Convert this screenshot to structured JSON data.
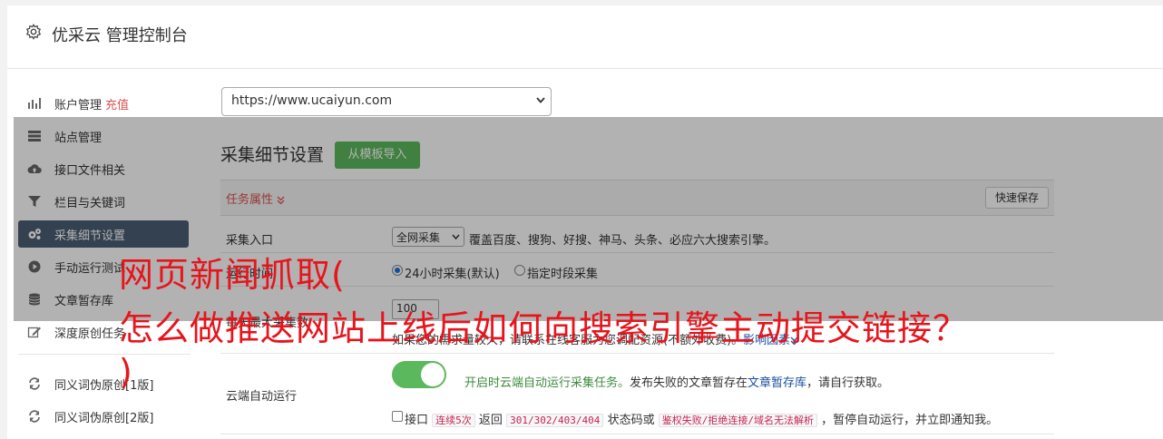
{
  "header": {
    "title": "优采云 管理控制台"
  },
  "sidebar": {
    "items": [
      {
        "label": "账户管理",
        "badge": "充值"
      },
      {
        "label": "站点管理"
      },
      {
        "label": "接口文件相关"
      },
      {
        "label": "栏目与关键词"
      },
      {
        "label": "采集细节设置"
      },
      {
        "label": "手动运行测试"
      },
      {
        "label": "文章暂存库"
      },
      {
        "label": "深度原创任务"
      },
      {
        "label": "同义词伪原创[1版]"
      },
      {
        "label": "同义词伪原创[2版]"
      }
    ]
  },
  "site_select": {
    "value": "https://www.ucaiyun.com"
  },
  "section": {
    "title": "采集细节设置",
    "import_button": "从模板导入",
    "task_attr": "任务属性",
    "save_button": "快速保存"
  },
  "rows": {
    "entry_label": "采集入口",
    "entry_select": "全网采集",
    "entry_desc": "覆盖百度、搜狗、好搜、神马、头条、必应六大搜索引擎。",
    "time_label": "运行时间",
    "time_opt1": "24小时采集(默认)",
    "time_opt2": "指定时段采集",
    "max_label": "每天最大采集数",
    "max_value": "100",
    "max_desc": "如果您的需求量较大，请联系在线客服为您调配资源(不额外收费)。",
    "max_link": "影响因素",
    "cloud_label": "云端自动运行",
    "cloud_on_text": "开启时云端自动运行采集任务。",
    "cloud_desc1": "发布失败的文章暂存在",
    "cloud_link": "文章暂存库",
    "cloud_desc2": "，请自行获取。",
    "chk_t1": "接口",
    "chk_c1": "连续5次",
    "chk_t2": "返回",
    "chk_c2": "301/302/403/404",
    "chk_t3": "状态码或",
    "chk_c3": "鉴权失败/拒绝连接/域名无法解析",
    "chk_t4": "，暂停自动运行，并立即通知我。"
  },
  "overlay": {
    "line1": "网页新闻抓取(",
    "line2": "怎么做推送网站上线后如何向搜索引擎主动提交链接？",
    "line3": ")"
  }
}
